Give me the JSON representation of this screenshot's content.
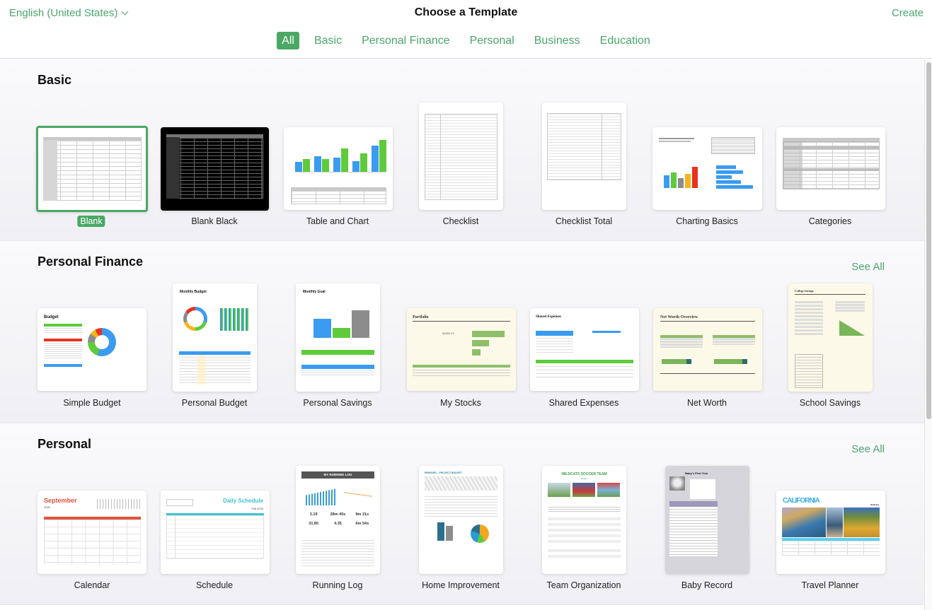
{
  "header": {
    "language": "English (United States)",
    "title": "Choose a Template",
    "create_label": "Create"
  },
  "tabs": [
    {
      "label": "All",
      "active": true
    },
    {
      "label": "Basic",
      "active": false
    },
    {
      "label": "Personal Finance",
      "active": false
    },
    {
      "label": "Personal",
      "active": false
    },
    {
      "label": "Business",
      "active": false
    },
    {
      "label": "Education",
      "active": false
    }
  ],
  "sections": [
    {
      "title": "Basic",
      "see_all": null,
      "templates": [
        {
          "name": "Blank",
          "selected": true
        },
        {
          "name": "Blank Black"
        },
        {
          "name": "Table and Chart"
        },
        {
          "name": "Checklist"
        },
        {
          "name": "Checklist Total"
        },
        {
          "name": "Charting Basics"
        },
        {
          "name": "Categories"
        }
      ]
    },
    {
      "title": "Personal Finance",
      "see_all": "See All",
      "templates": [
        {
          "name": "Simple Budget",
          "preview_title": "Budget"
        },
        {
          "name": "Personal Budget",
          "preview_title": "Monthly Budget"
        },
        {
          "name": "Personal Savings",
          "preview_title": "Monthly Goal"
        },
        {
          "name": "My Stocks",
          "preview_title": "Portfolio",
          "preview_value": "$2653.13"
        },
        {
          "name": "Shared Expenses",
          "preview_title": "Shared Expenses"
        },
        {
          "name": "Net Worth",
          "preview_title": "Net Worth Overview"
        },
        {
          "name": "School Savings",
          "preview_title": "College Savings"
        }
      ]
    },
    {
      "title": "Personal",
      "see_all": "See All",
      "templates": [
        {
          "name": "Calendar",
          "preview_title": "September",
          "preview_sub": "2020"
        },
        {
          "name": "Schedule",
          "preview_title": "Daily Schedule",
          "preview_sub": "Fall 2020"
        },
        {
          "name": "Running Log",
          "preview_title": "MY RUNNING LOG",
          "preview_stats": [
            "3.19",
            "28m 40s",
            "9m 21s",
            "31.85",
            "4.35",
            "6m 54s"
          ]
        },
        {
          "name": "Home Improvement",
          "preview_title": "REMODEL - PROJECT BUDGET"
        },
        {
          "name": "Team Organization",
          "preview_title": "WILDCATS SOCCER TEAM",
          "preview_sub": "Roster"
        },
        {
          "name": "Baby Record",
          "preview_title": "Baby's First Year"
        },
        {
          "name": "Travel Planner",
          "preview_title": "CALIFORNIA",
          "preview_sub": "Itinerary"
        }
      ]
    }
  ],
  "colors": {
    "accent": "#4aa864",
    "accent_text": "#4aa56e",
    "chart_blue": "#3a9bf0",
    "chart_green": "#5ecb3a",
    "chart_red": "#e8321e",
    "chart_orange": "#f5b51c",
    "chart_gray": "#8c8c8c"
  }
}
